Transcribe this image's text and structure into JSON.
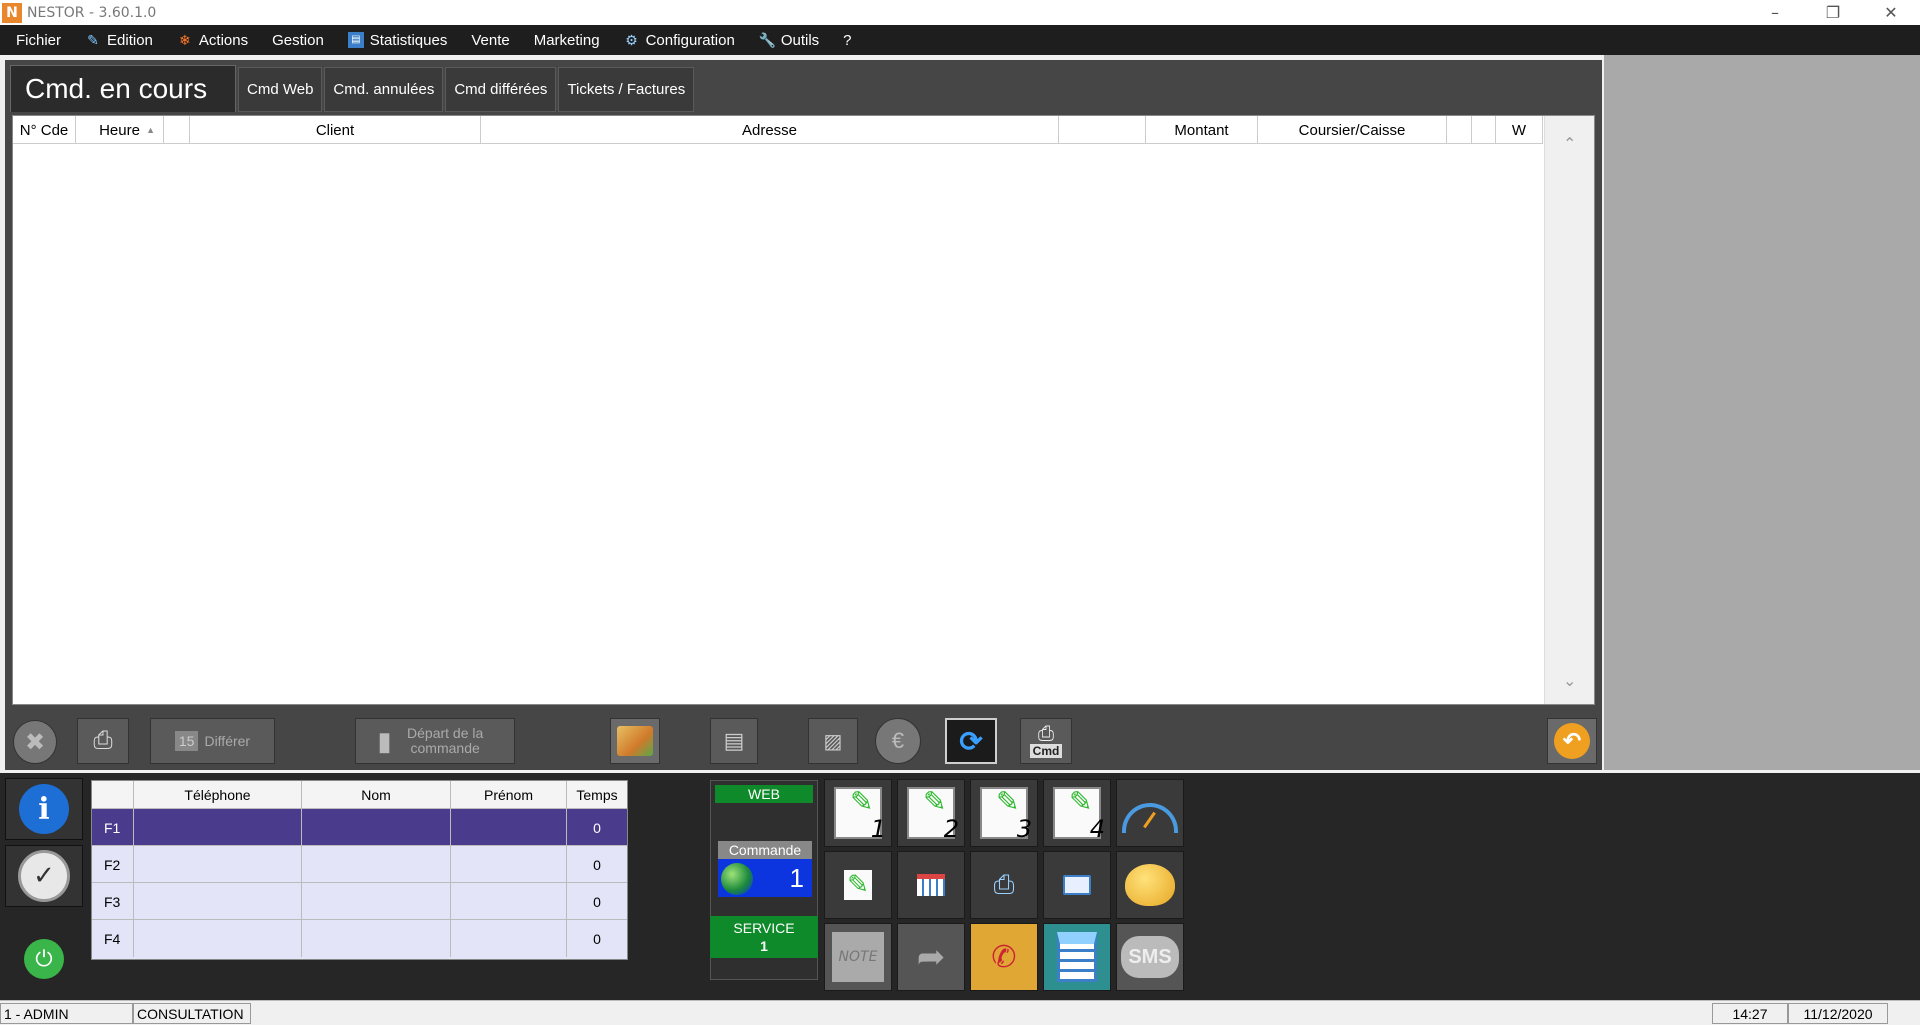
{
  "window": {
    "title": "NESTOR - 3.60.1.0",
    "app_icon": "N"
  },
  "menu": [
    {
      "label": "Fichier",
      "icon": ""
    },
    {
      "label": "Edition",
      "icon": "edit-icon"
    },
    {
      "label": "Actions",
      "icon": "fire-icon"
    },
    {
      "label": "Gestion",
      "icon": ""
    },
    {
      "label": "Statistiques",
      "icon": "chart-icon"
    },
    {
      "label": "Vente",
      "icon": ""
    },
    {
      "label": "Marketing",
      "icon": ""
    },
    {
      "label": "Configuration",
      "icon": "gear-icon"
    },
    {
      "label": "Outils",
      "icon": "wrench-icon"
    },
    {
      "label": "?",
      "icon": ""
    }
  ],
  "main": {
    "title": "Cmd. en cours",
    "tabs": [
      "Cmd Web",
      "Cmd. annulées",
      "Cmd différées",
      "Tickets / Factures"
    ],
    "columns": [
      "N° Cde",
      "Heure",
      "",
      "Client",
      "Adresse",
      "",
      "Montant",
      "Coursier/Caisse",
      "",
      "",
      "W"
    ]
  },
  "toolbar": {
    "differer_label": "Différer",
    "depart_label": "Départ de la commande",
    "cmd_print_label": "Cmd"
  },
  "calls": {
    "columns": [
      "Téléphone",
      "Nom",
      "Prénom",
      "Temps"
    ],
    "rows": [
      {
        "key": "F1",
        "telephone": "",
        "nom": "",
        "prenom": "",
        "temps": "0"
      },
      {
        "key": "F2",
        "telephone": "",
        "nom": "",
        "prenom": "",
        "temps": "0"
      },
      {
        "key": "F3",
        "telephone": "",
        "nom": "",
        "prenom": "",
        "temps": "0"
      },
      {
        "key": "F4",
        "telephone": "",
        "nom": "",
        "prenom": "",
        "temps": "0"
      }
    ]
  },
  "web": {
    "label": "WEB",
    "commande_label": "Commande",
    "commande_count": "1",
    "service_label": "SERVICE",
    "service_count": "1"
  },
  "quick_tiles": {
    "notepad_numbers": [
      "1",
      "2",
      "3",
      "4"
    ],
    "sms_label": "SMS",
    "note_label": "NOTE"
  },
  "status": {
    "user": "1 - ADMIN",
    "mode": "CONSULTATION",
    "time": "14:27",
    "date": "11/12/2020"
  },
  "colors": {
    "menubar": "#1e1e1e",
    "frame": "#464646",
    "selected_row": "#4b3b8c",
    "web_green": "#0e8a2a",
    "cmd_blue": "#0c35e0"
  }
}
